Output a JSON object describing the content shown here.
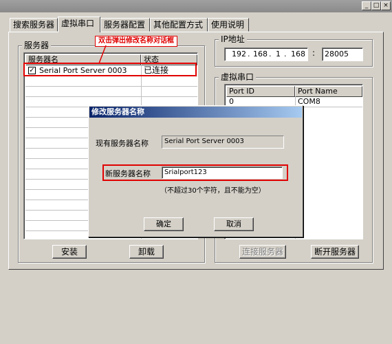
{
  "window": {
    "controls": [
      "_",
      "□",
      "×"
    ]
  },
  "tabs": [
    {
      "label": "搜索服务器"
    },
    {
      "label": "虚拟串口"
    },
    {
      "label": "服务器配置"
    },
    {
      "label": "其他配置方式"
    },
    {
      "label": "使用说明"
    }
  ],
  "servers": {
    "group_title": "服务器",
    "columns": [
      "服务器名",
      "状态"
    ],
    "rows": [
      {
        "name": "Serial Port Server 0003",
        "status": "已连接",
        "checked": true
      }
    ],
    "install_button": "安装",
    "uninstall_button": "卸载"
  },
  "annotation": {
    "callout": "双击弹出修改名称对话框"
  },
  "ip": {
    "group_title": "IP地址",
    "octets": [
      "192",
      "168",
      "1",
      "168"
    ],
    "port": "28005"
  },
  "virtual_ports": {
    "group_title": "虚拟串口",
    "columns": [
      "Port ID",
      "Port Name"
    ],
    "rows": [
      {
        "id": "0",
        "name": "COM8"
      }
    ],
    "connect_button": "连接服务器",
    "disconnect_button": "断开服务器"
  },
  "dialog": {
    "title": "修改服务器名称",
    "current_label": "现有服务器名称",
    "current_value": "Serial Port Server 0003",
    "new_label": "新服务器名称",
    "new_value": "Srialport123",
    "hint": "（不超过30个字符，且不能为空）",
    "ok_button": "确定",
    "cancel_button": "取消"
  }
}
